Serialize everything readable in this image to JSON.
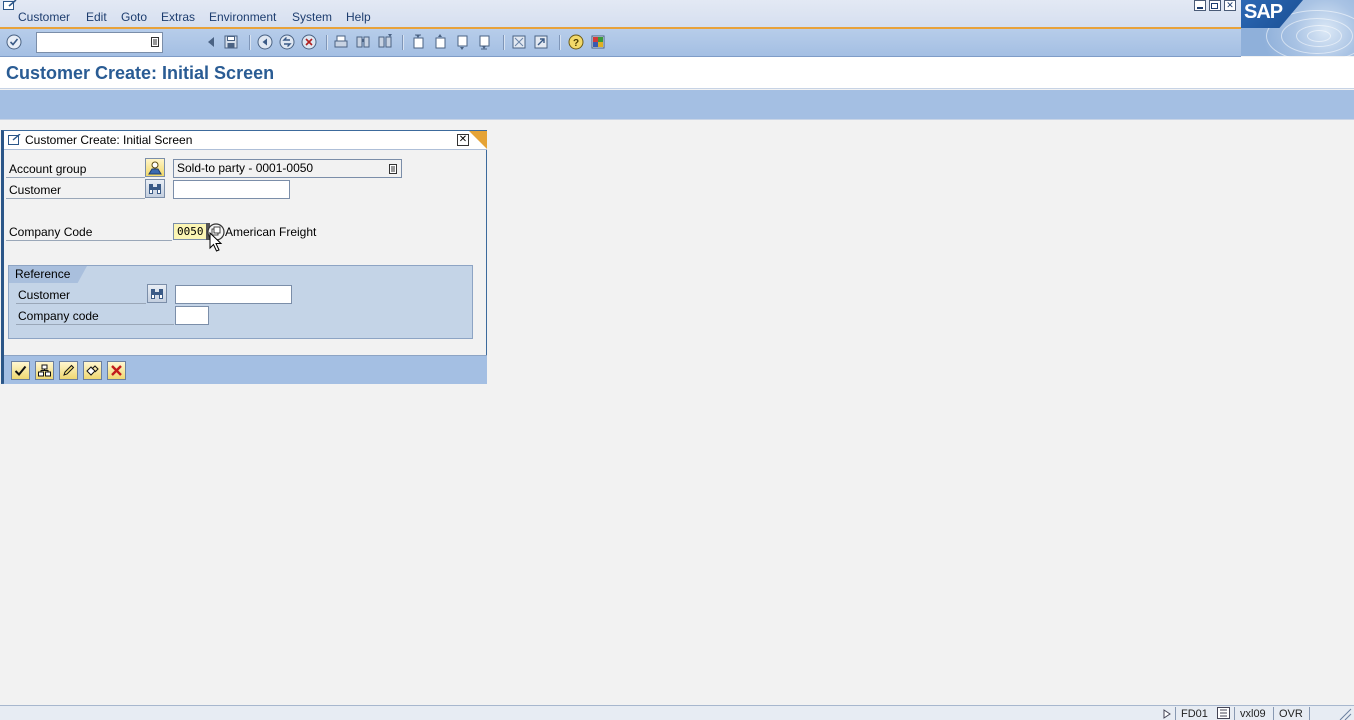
{
  "menubar": {
    "items": [
      "Customer",
      "Edit",
      "Goto",
      "Extras",
      "Environment",
      "System",
      "Help"
    ]
  },
  "logo": {
    "text": "SAP"
  },
  "toolbar": {
    "command_field": {
      "value": "",
      "placeholder": ""
    },
    "icons": [
      "enter-icon",
      "back-nav-icon",
      "save-icon",
      "back-icon",
      "exit-icon",
      "cancel-icon",
      "print-icon",
      "find-icon",
      "find-next-icon",
      "first-page-icon",
      "previous-page-icon",
      "next-page-icon",
      "last-page-icon",
      "create-session-icon",
      "shortcut-icon",
      "help-icon",
      "layout-icon"
    ]
  },
  "page": {
    "title": "Customer Create: Initial Screen"
  },
  "dialog": {
    "title": "Customer Create: Initial Screen",
    "fields": {
      "account_group": {
        "label": "Account group",
        "value": "Sold-to party - 0001-0050"
      },
      "customer": {
        "label": "Customer",
        "value": ""
      },
      "company_code": {
        "label": "Company Code",
        "value": "0050",
        "description": "American Freight"
      }
    },
    "reference": {
      "title": "Reference",
      "customer": {
        "label": "Customer",
        "value": ""
      },
      "company_code": {
        "label": "Company code",
        "value": ""
      }
    },
    "footer_buttons": [
      "continue-icon",
      "org-levels-icon",
      "edit-icon",
      "data-icon",
      "cancel-icon"
    ]
  },
  "statusbar": {
    "transaction": "FD01",
    "server": "vxl09",
    "mode": "OVR"
  },
  "colors": {
    "toolbar_blue": "#a4bfe3",
    "title_blue": "#2a5c94",
    "accent_orange": "#e8a23a",
    "required_yellow": "#fbf5b4"
  }
}
